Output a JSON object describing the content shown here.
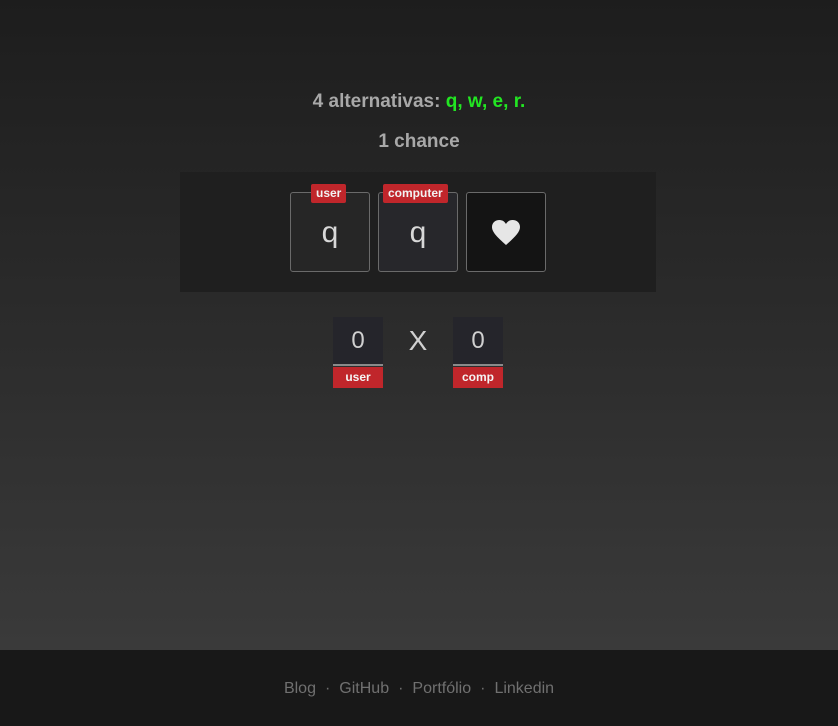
{
  "header": {
    "alternatives_prefix": "4 alternativas: ",
    "options": [
      "q",
      "w",
      "e",
      "r"
    ],
    "chances": "1 chance"
  },
  "arena": {
    "user_tag": "user",
    "computer_tag": "computer",
    "user_choice": "q",
    "computer_choice": "q",
    "life_icon": "heart-icon"
  },
  "scoreboard": {
    "user_score": "0",
    "user_label": "user",
    "versus": "X",
    "computer_score": "0",
    "computer_label": "comp"
  },
  "footer": {
    "links": [
      "Blog",
      "GitHub",
      "Portfólio",
      "Linkedin"
    ],
    "separator": "·"
  },
  "colors": {
    "option_highlight": "#22e622",
    "tag_red": "#c0262b",
    "text_gray": "#a8a8a8"
  }
}
